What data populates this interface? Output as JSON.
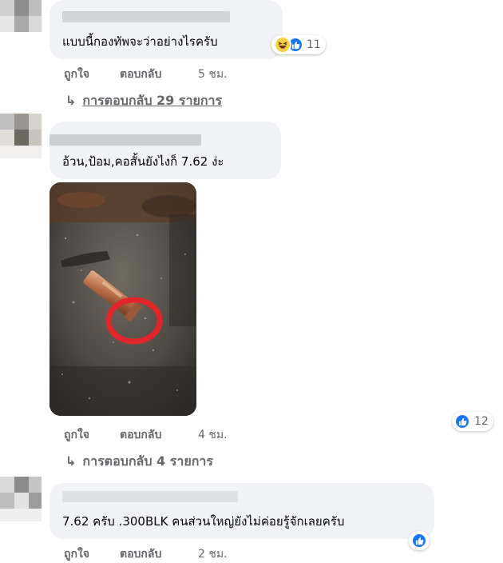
{
  "comments": [
    {
      "text": "แบบนี้กองทัพจะว่าอย่างไรครับ",
      "like_label": "ถูกใจ",
      "reply_label": "ตอบกลับ",
      "time": "5 ชม.",
      "reactions_count": "11",
      "reaction_icons": [
        "haha-icon",
        "like-icon"
      ],
      "replies_text": "การตอบกลับ 29 รายการ"
    },
    {
      "text": "อ้วน,ป้อม,คอสั้นยังไงก็ 7.62 ง่ะ",
      "like_label": "ถูกใจ",
      "reply_label": "ตอบกลับ",
      "time": "4 ชม.",
      "reactions_count": "12",
      "reaction_icons": [
        "like-icon"
      ],
      "replies_text": "การตอบกลับ 4 รายการ",
      "photo_description": "bullet-casing-photo"
    },
    {
      "text": "7.62 ครับ .300BLK คนส่วนใหญ่ยังไม่ค่อยรู้จักเลยครับ",
      "like_label": "ถูกใจ",
      "reply_label": "ตอบกลับ",
      "time": "2 ชม.",
      "reaction_icons": [
        "like-icon"
      ]
    }
  ],
  "reply_arrow": "↳",
  "colors": {
    "bubble": "#f0f2f5",
    "meta_text": "#65676b",
    "like_blue": "#1877f2"
  }
}
